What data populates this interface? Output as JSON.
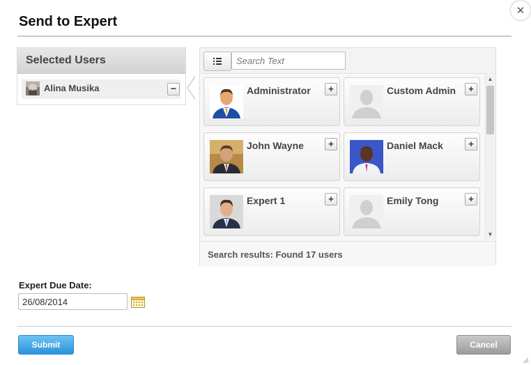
{
  "dialog": {
    "title": "Send to Expert",
    "close_glyph": "✕"
  },
  "selected_users": {
    "header": "Selected Users",
    "items": [
      {
        "name": "Alina Musika",
        "remove_glyph": "−"
      }
    ]
  },
  "search": {
    "placeholder": "Search Text",
    "value": "",
    "list_view_icon": "list-icon",
    "results_text": "Search results: Found 17 users",
    "users": [
      {
        "name": "Administrator",
        "photo": "cartoon-avatar",
        "add_glyph": "+"
      },
      {
        "name": "Custom Admin",
        "photo": "default-avatar",
        "add_glyph": "+"
      },
      {
        "name": "John Wayne",
        "photo": "photo",
        "add_glyph": "+"
      },
      {
        "name": "Daniel Mack",
        "photo": "photo",
        "add_glyph": "+"
      },
      {
        "name": "Expert 1",
        "photo": "photo",
        "add_glyph": "+"
      },
      {
        "name": "Emily Tong",
        "photo": "default-avatar",
        "add_glyph": "+"
      }
    ]
  },
  "due_date": {
    "label": "Expert Due Date:",
    "value": "26/08/2014",
    "calendar_icon": "calendar-icon"
  },
  "buttons": {
    "submit": "Submit",
    "cancel": "Cancel"
  },
  "colors": {
    "submit_bg": "#2a93db",
    "cancel_bg": "#9b9b9b"
  }
}
